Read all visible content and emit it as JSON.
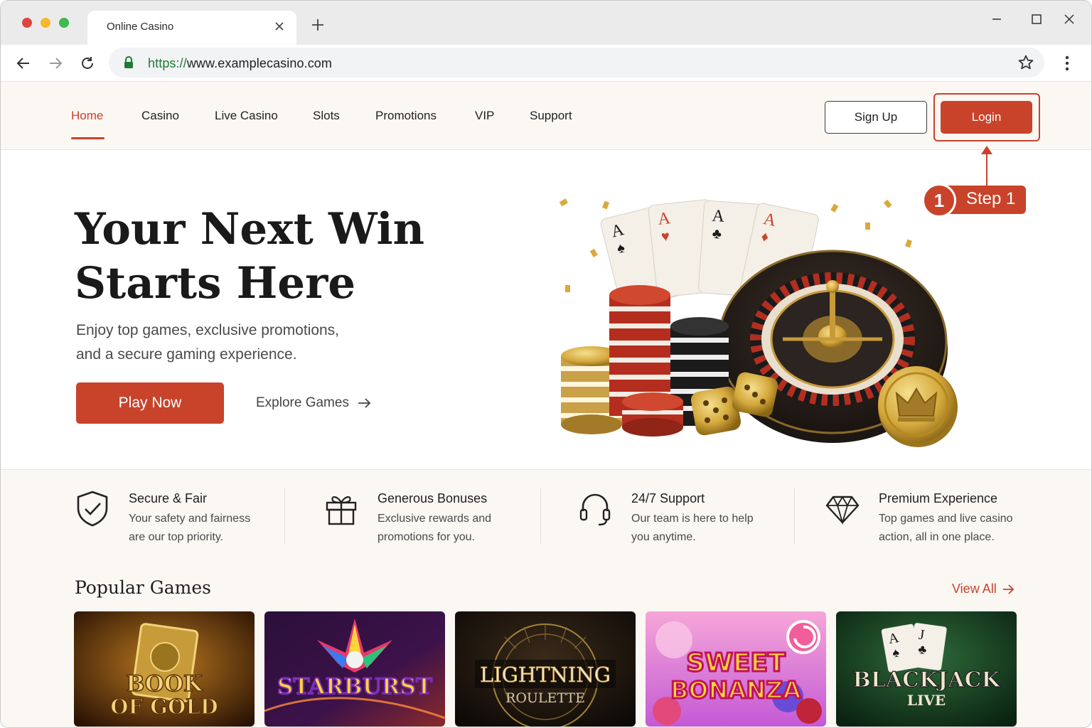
{
  "browser": {
    "tab_title": "Online Casino",
    "url_scheme": "https://",
    "url_rest": "www.examplecasino.com"
  },
  "nav": {
    "items": [
      {
        "label": "Home",
        "active": true
      },
      {
        "label": "Casino"
      },
      {
        "label": "Live Casino"
      },
      {
        "label": "Slots"
      },
      {
        "label": "Promotions"
      },
      {
        "label": "VIP"
      },
      {
        "label": "Support"
      }
    ],
    "signup_label": "Sign Up",
    "login_label": "Login"
  },
  "annotation": {
    "step_number": "1",
    "step_label": "Step 1"
  },
  "hero": {
    "title_line1": "Your Next Win",
    "title_line2": "Starts Here",
    "subtitle_line1": "Enjoy top games, exclusive promotions,",
    "subtitle_line2": "and a secure gaming experience.",
    "play_label": "Play Now",
    "explore_label": "Explore Games"
  },
  "features": [
    {
      "icon": "shield-check-icon",
      "title": "Secure & Fair",
      "desc_line1": "Your safety and fairness",
      "desc_line2": "are our top priority."
    },
    {
      "icon": "gift-icon",
      "title": "Generous Bonuses",
      "desc_line1": "Exclusive rewards and",
      "desc_line2": "promotions for you."
    },
    {
      "icon": "headset-icon",
      "title": "24/7 Support",
      "desc_line1": "Our team is here to help",
      "desc_line2": "you anytime."
    },
    {
      "icon": "diamond-icon",
      "title": "Premium Experience",
      "desc_line1": "Top games and live casino",
      "desc_line2": "action, all in one place."
    }
  ],
  "popular": {
    "title": "Popular Games",
    "view_all_label": "View All",
    "games": [
      {
        "line1": "BOOK",
        "line2": "OF GOLD"
      },
      {
        "line1": "STARBURST",
        "line2": ""
      },
      {
        "line1": "LIGHTNING",
        "line2": "ROULETTE"
      },
      {
        "line1": "SWEET",
        "line2": "BONANZA"
      },
      {
        "line1": "BLACKJACK",
        "line2": "LIVE"
      }
    ]
  },
  "colors": {
    "accent": "#c8432a",
    "band": "#fbf7f3",
    "text": "#1f1f1f"
  }
}
